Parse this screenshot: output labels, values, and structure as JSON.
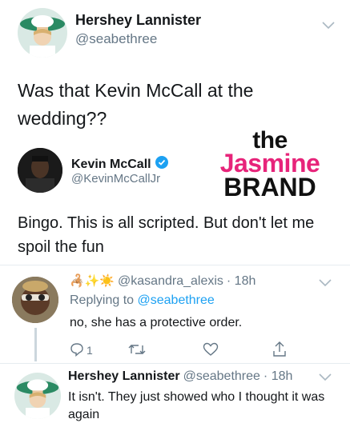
{
  "tweet": {
    "author_name": "Hershey Lannister",
    "author_handle": "@seabethree",
    "text": "Was that Kevin McCall at the wedding??"
  },
  "quoted": {
    "author_name": "Kevin McCall",
    "author_handle": "@KevinMcCallJr",
    "text": "Bingo. This is all scripted. But don't let me spoil the fun"
  },
  "watermark": {
    "the": "the",
    "jasmine": "Jasmine",
    "brand": "BRAND",
    "accent_color": "#e7247a"
  },
  "reply1": {
    "emojis": "🦂✨☀️",
    "author_handle": "@kasandra_alexis",
    "time": "· 18h",
    "replying_prefix": "Replying to",
    "replying_to": "@seabethree",
    "text": "no, she has a protective order.",
    "reply_count": "1"
  },
  "reply2": {
    "author_name": "Hershey Lannister",
    "author_handle": "@seabethree",
    "time": "· 18h",
    "text": "It isn't. They just showed who I thought it was again"
  },
  "icons": [
    "chevron-down-icon",
    "verified-badge-icon",
    "reply-icon",
    "retweet-icon",
    "like-icon",
    "share-icon"
  ],
  "colors": {
    "link": "#1da1f2",
    "muted": "#657786",
    "verified": "#1da1f2"
  }
}
